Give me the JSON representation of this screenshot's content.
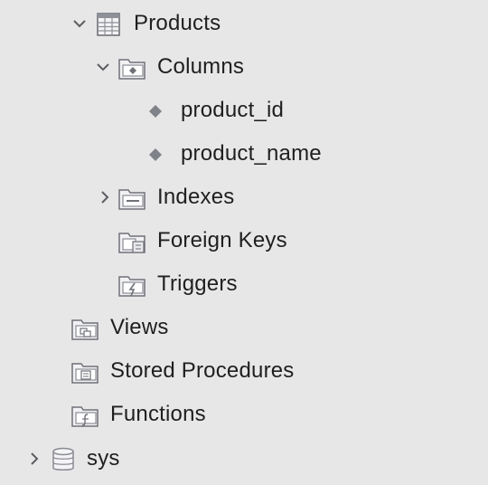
{
  "tree": {
    "products_label": "Products",
    "columns_label": "Columns",
    "column_items": [
      "product_id",
      "product_name"
    ],
    "indexes_label": "Indexes",
    "foreign_keys_label": "Foreign Keys",
    "triggers_label": "Triggers",
    "views_label": "Views",
    "stored_procedures_label": "Stored Procedures",
    "functions_label": "Functions",
    "sys_label": "sys"
  },
  "icons": {
    "products": "table-icon",
    "columns": "columns-folder-icon",
    "column_item": "column-diamond-icon",
    "indexes": "indexes-folder-icon",
    "foreign_keys": "foreign-keys-folder-icon",
    "triggers": "triggers-folder-icon",
    "views": "views-folder-icon",
    "stored_procedures": "stored-procedures-folder-icon",
    "functions": "functions-folder-icon",
    "sys": "database-icon"
  },
  "colors": {
    "background": "#e8e7e8",
    "text": "#1f1f1f",
    "icon_gray": "#7d7f86"
  }
}
